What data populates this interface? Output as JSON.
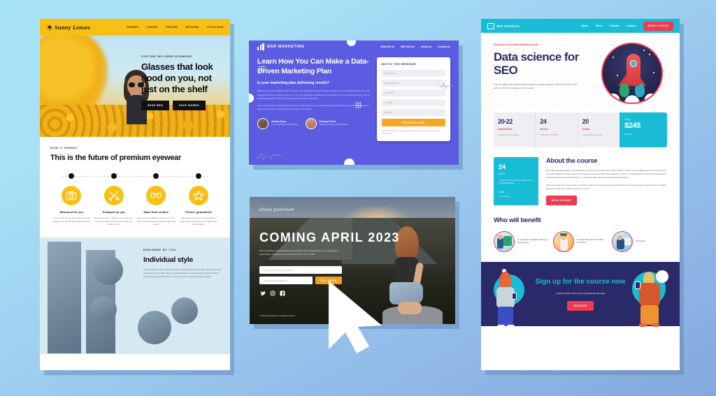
{
  "background": {
    "from": "#a5e3f7",
    "to": "#86a8dd"
  },
  "mockups": [
    {
      "id": "sunny-lenses",
      "brand": "Sunny Lenses",
      "nav": [
        "FRAMES",
        "LENSES",
        "PRICING",
        "REVIEWS",
        "LOCATIONS"
      ],
      "hero": {
        "eyebrow": "CUSTOM-TAILORED EYEWEAR",
        "headline": "Glasses that look good on you, not just on the shelf",
        "buttons": [
          "SHOP MEN",
          "SHOP WOMEN"
        ]
      },
      "how": {
        "kicker": "HOW IT WORKS",
        "heading": "This is the future of premium eyewear",
        "features": [
          {
            "icon": "camera-icon",
            "title": "Measured for you",
            "text": "Use our 3D app to scan your face and capture over 30,000 3D measurements."
          },
          {
            "icon": "tools-icon",
            "title": "Designed by you",
            "text": "Select your style, choose your color, fine-tune the shape, and preview it with our virtual try-on."
          },
          {
            "icon": "glasses-icon",
            "title": "Made from scratch",
            "text": "Each pair is crafted for one person at a time from the highest quality acetate and metal."
          },
          {
            "icon": "star-icon",
            "title": "Perfect, guaranteed",
            "text": "We guarantee your luxury bespoke glasses will fit perfectly, look great and feel amazing."
          }
        ]
      },
      "style": {
        "kicker": "DESIGNED BY YOU",
        "heading": "Individual style",
        "text": "After a bespoke suit or couture dress, exceptional eyewear starts with fit that was made just for you. We craft your glasses based on your distinct stylistic choices and your personal preferences, so you're free to truly express yourself."
      }
    },
    {
      "id": "bar-marketing",
      "brand": "BAR MARKETING",
      "nav": [
        "What We Do",
        "Who We Are",
        "About Us",
        "Contact Us"
      ],
      "headline": "Learn How You Can Make a Data-Driven Marketing Plan",
      "subhead": "Is your marketing plan delivering results?",
      "paragraph1": "Marketing your firm should never be reactive. Bar Marketing conducts ongoing research to find out what delivers the best results and what is a waste of time, so you can be proactive. Whether you are adjusting for the second half of this year or already planning for 2023, having the right framework is essential.",
      "paragraph2": "Jeremy Avery and Penelope Perez are here to field answer all your marketing questions at this free webinar, focusing on creating data-driven marketing plans that drive real results.",
      "speakers": [
        {
          "name": "Jeremy Avery",
          "title": "Senior Marketing, Bar Marketing"
        },
        {
          "name": "Penelope Perez",
          "title": "Marketing Manager, Bar Marketing"
        }
      ],
      "form": {
        "title": "WATCH THE WEBINAR",
        "fields": [
          "Full Name*",
          "Email Address*",
          "Company",
          "Job Title",
          "Industry"
        ],
        "submit": "REGISTER NOW",
        "note": "View this webinar now and get notifications when we post new content or similar links."
      }
    },
    {
      "id": "coming-april",
      "logo": "alexa peterson",
      "headline": "COMING APRIL 2023",
      "paragraph": "My Travel Blog is almost ready. Be one of the first to experience it by entering your email below. I'll notify you as soon as it's live. Let's do this!",
      "fields": [
        "Enter Your First and Last Name",
        "Enter Your Email Address"
      ],
      "submit": "YES, I'M IN!",
      "social": [
        "twitter-icon",
        "instagram-icon",
        "facebook-icon"
      ],
      "copyright": "© 2023 Alexa Peterson. All Rights Reserved."
    },
    {
      "id": "seo-solutions",
      "brand": "SEO Solutions",
      "nav": [
        "About",
        "Tutors",
        "Program",
        "Location"
      ],
      "nav_cta": "BOOK A PLACE",
      "hero": {
        "discover": "Discover new data analytics tools",
        "headline": "Data science for SEO",
        "paragraph": "Learn to gather and analyse data provided by Google Analytics, search consoles & web servers with our new data science course."
      },
      "stats": [
        {
          "num": "20-22",
          "label": "September",
          "sub": "3 days of intense practice"
        },
        {
          "num": "24",
          "label": "Hours",
          "sub": "10:00 AM — 6:00 PM"
        },
        {
          "num": "20",
          "label": "Seats",
          "sub": "Limited number of seats"
        }
      ],
      "price": {
        "label": "Price",
        "value": "$245",
        "sub": "Best offer"
      },
      "about": {
        "heading": "About the course",
        "card": {
          "num": "24",
          "label": "Hours",
          "text": "of practice and immersion in data science for SEO specialists",
          "level_label": "Level",
          "level": "Intermediate"
        },
        "p1": "Every day, Google Analytics, Google Search Console and your web server collect millions of data rows, and SEO experts often only look at summary graphs and rejoice when they increase and get upset when they decrease. It's time to understand the causes and consequences and take the first steps in Data Science — dig into the data with your head and find the answers.",
        "p2": "There is no need to invent Google's conspiracy theories if you can find out how data science works and learn the major techniques in SEO. Book your seat to get instant access to the course.",
        "button": "BOOK A PLACE"
      },
      "benefit": {
        "heading": "Who will benefit",
        "items": [
          "In-house SEO specialists working on large projects",
          "Licensed SEO experts and SEO enthusiasts",
          "SEO geeks"
        ]
      },
      "footer": {
        "headline": "Sign up for the course now",
        "sub": "and get a PDF course report & certificate via email",
        "button": "REGISTER"
      }
    }
  ],
  "cursor": {
    "name": "mouse-pointer"
  }
}
